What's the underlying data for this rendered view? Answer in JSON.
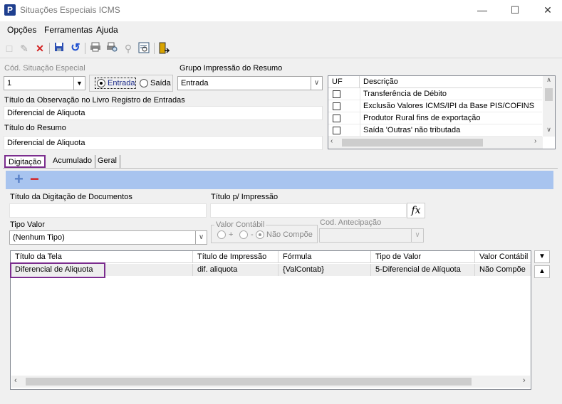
{
  "window": {
    "title": "Situações Especiais ICMS",
    "app_icon": "P",
    "controls": {
      "minimize": "—",
      "maximize": "☐",
      "close": "✕"
    }
  },
  "menu": [
    "Opções",
    "Ferramentas",
    "Ajuda"
  ],
  "toolbar_icons": [
    "new-doc-icon",
    "edit-pencil-icon",
    "delete-x-icon",
    "save-disk-icon",
    "undo-icon",
    "print-icon",
    "print-preview-icon",
    "search-key-icon",
    "view-report-icon",
    "exit-door-icon"
  ],
  "form": {
    "cod_label": "Cód. Situação Especial",
    "cod_value": "1",
    "radio_entrada": "Entrada",
    "radio_saida": "Saída",
    "grupo_label": "Grupo Impressão do Resumo",
    "grupo_value": "Entrada",
    "obs_label": "Título da Observação no Livro Registro de Entradas",
    "obs_value": "Diferencial de Aliquota",
    "resumo_label": "Título do Resumo",
    "resumo_value": "Diferencial de Aliquota"
  },
  "uf_table": {
    "headers": [
      "UF",
      "Descrição"
    ],
    "rows": [
      "Transferência de Débito",
      "Exclusão Valores ICMS/IPI da Base PIS/COFINS",
      "Produtor Rural fins de exportação",
      "Saída 'Outras' não tributada"
    ]
  },
  "tabs": [
    "Digitação",
    "Acumulado",
    "Geral"
  ],
  "digitacao": {
    "add_symbol": "+",
    "remove_symbol": "−",
    "titulo_digitacao_label": "Título da Digitação de Documentos",
    "titulo_impressao_label": "Título p/ Impressão",
    "fx_label": "fx",
    "tipo_valor_label": "Tipo Valor",
    "tipo_valor_value": "(Nenhum Tipo)",
    "valor_contabil_legend": "Valor Contábil",
    "vc_plus": "+",
    "vc_minus": "-",
    "vc_nao_compoe": "Não Compõe",
    "cod_antecipacao_label": "Cod. Antecipação"
  },
  "grid": {
    "headers": [
      "Título da Tela",
      "Título de Impressão",
      "Fórmula",
      "Tipo de Valor",
      "Valor Contábil"
    ],
    "rows": [
      [
        "Diferencial de Aliquota",
        "dif. aliquota",
        "{ValContab}",
        "5-Diferencial de Alíquota",
        "Não Compõe"
      ]
    ]
  },
  "colors": {
    "highlight": "#7b2d8e",
    "panel": "#a8c4ef"
  }
}
